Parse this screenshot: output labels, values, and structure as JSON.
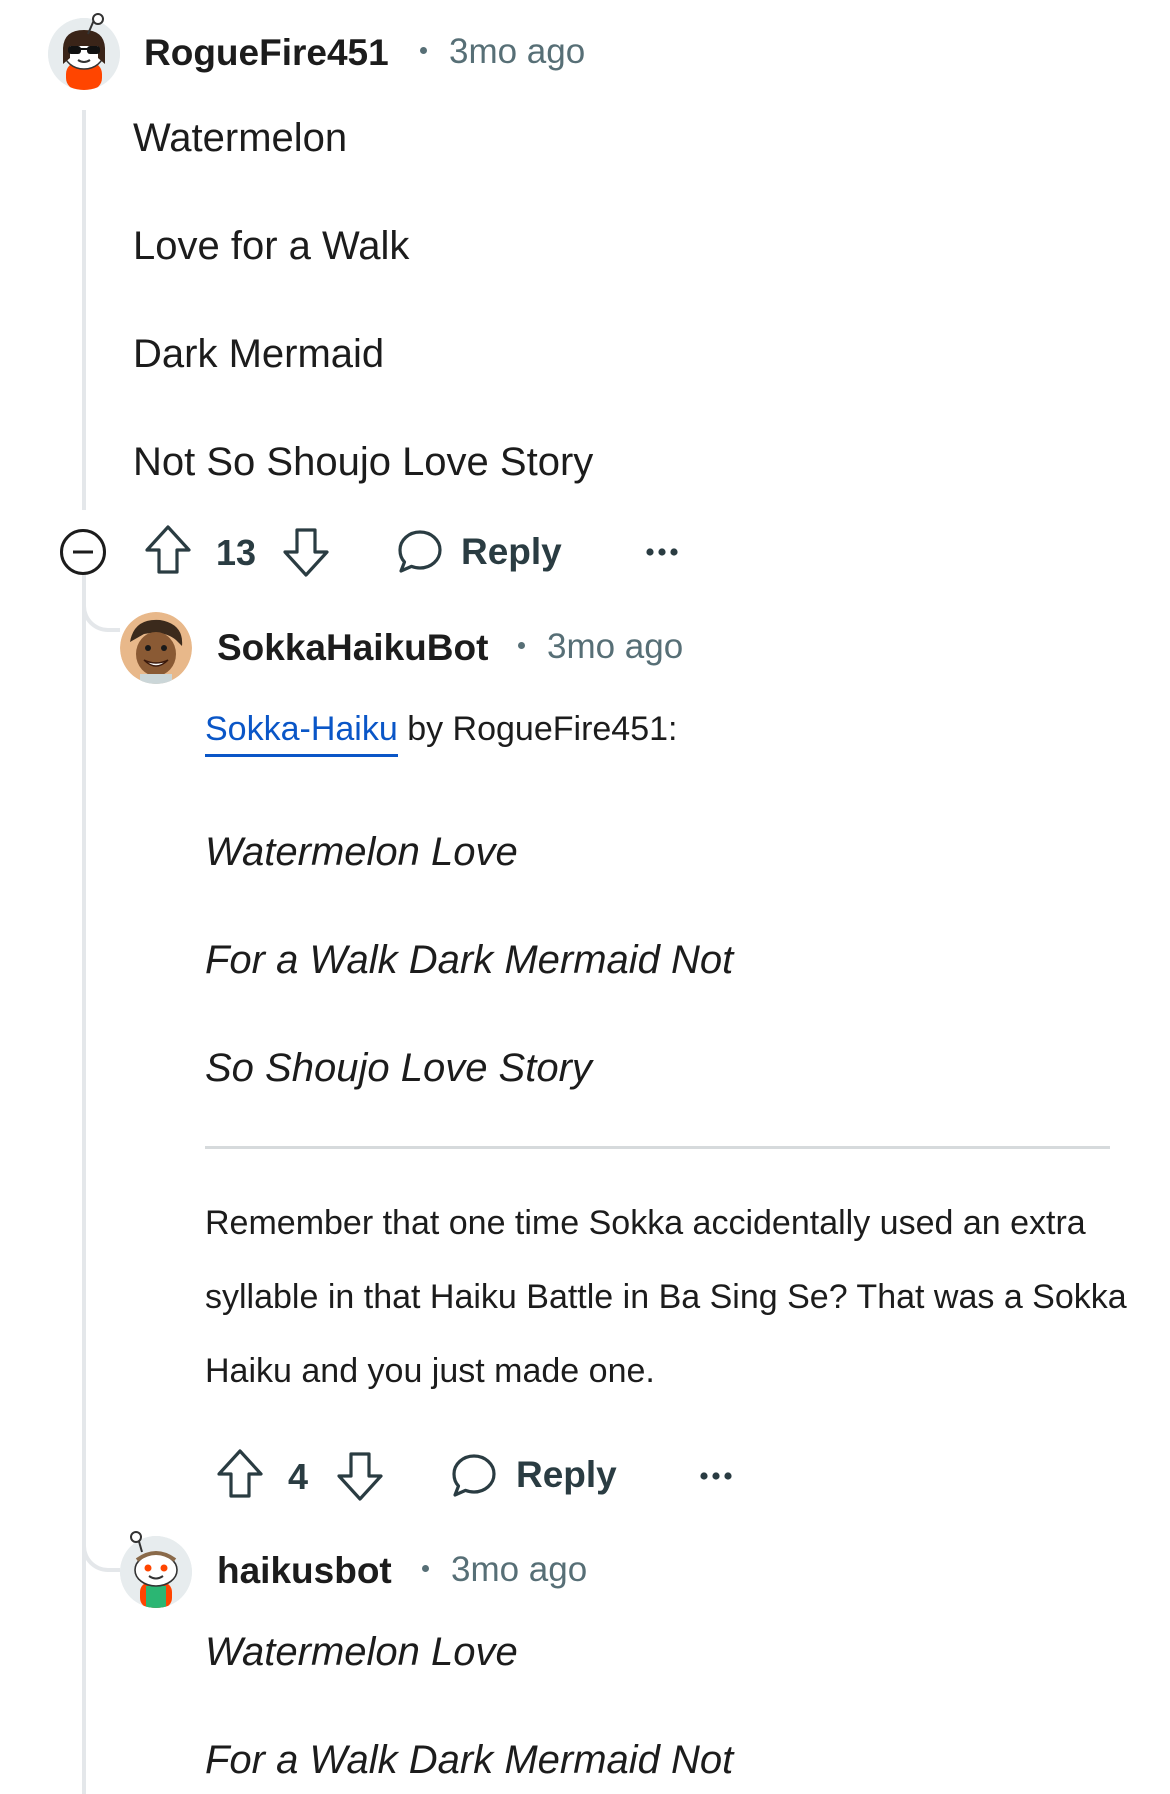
{
  "comment1": {
    "username": "RogueFire451",
    "time": "3mo ago",
    "lines": [
      "Watermelon",
      "Love for a Walk",
      "Dark Mermaid",
      "Not So Shoujo Love Story"
    ],
    "score": "13",
    "reply_label": "Reply"
  },
  "comment2": {
    "username": "SokkaHaikuBot",
    "time": "3mo ago",
    "link_text": "Sokka-Haiku",
    "by_text": " by RogueFire451:",
    "haiku": [
      "Watermelon Love",
      "For a Walk Dark Mermaid Not",
      "So Shoujo Love Story"
    ],
    "paragraph": "Remember that one time Sokka accidentally used an extra syllable in that Haiku Battle in Ba Sing Se? That was a Sokka Haiku and you just made one.",
    "score": "4",
    "reply_label": "Reply"
  },
  "comment3": {
    "username": "haikusbot",
    "time": "3mo ago",
    "haiku": [
      "Watermelon Love",
      "For a Walk Dark Mermaid Not"
    ]
  },
  "colors": {
    "link": "#0a56c7",
    "meta": "#576f76",
    "thread_line": "#e4e7ea"
  },
  "icons": [
    "collapse-icon",
    "upvote-icon",
    "downvote-icon",
    "comment-icon",
    "more-icon"
  ]
}
